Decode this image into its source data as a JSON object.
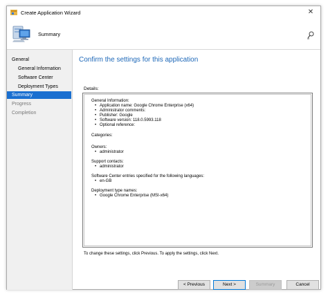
{
  "window": {
    "title": "Create Application Wizard",
    "close_glyph": "✕"
  },
  "header": {
    "title": "Summary",
    "icon": "computer-icon",
    "help_icon": "help-icon"
  },
  "sidebar": {
    "items": [
      {
        "label": "General"
      },
      {
        "label": "General Information"
      },
      {
        "label": "Software Center"
      },
      {
        "label": "Deployment Types"
      },
      {
        "label": "Summary"
      },
      {
        "label": "Progress"
      },
      {
        "label": "Completion"
      }
    ],
    "selected_color": "#1a6fd0"
  },
  "main": {
    "title": "Confirm the settings for this application",
    "details_label": "Details:",
    "details": {
      "general_heading": "General Information:",
      "general_items": [
        "Application name: Google Chrome Enterprise (x64)",
        "Administrator comments:",
        "Publisher: Google",
        "Software version: 118.0.5993.118",
        "Optional reference:"
      ],
      "categories_heading": "Categories:",
      "owners_heading": "Owners:",
      "owners_items": [
        "administrator"
      ],
      "support_heading": "Support contacts:",
      "support_items": [
        "administrator"
      ],
      "languages_heading": "Software Center entries specified for the following languages:",
      "languages_items": [
        "en-GB"
      ],
      "deployment_heading": "Deployment type names:",
      "deployment_items": [
        "Google Chrome Enterprise (MSI-x64)"
      ]
    },
    "instruction": "To change these settings, click Previous. To apply the settings, click Next."
  },
  "buttons": {
    "previous": "< Previous",
    "next": "Next >",
    "summary": "Summary",
    "cancel": "Cancel"
  },
  "colors": {
    "accent": "#1c67b8",
    "selection": "#1a6fd0"
  }
}
